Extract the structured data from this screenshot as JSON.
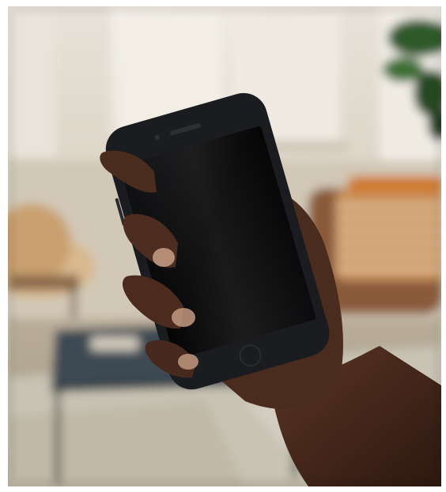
{
  "photo": {
    "subject": "hand-holding-smartphone",
    "screen_state": "off",
    "colors": {
      "wall": "#d8cfbf",
      "window_light": "#eeeae2",
      "plant": "#2f5a2a",
      "pillow": "#c9935e",
      "chair": "#8a5a3a",
      "table": "#3d4a52",
      "rug": "#c8c3b4",
      "skin": "#4a2c1f",
      "phone_body": "#1b1c1f",
      "phone_screen": "#060607"
    }
  }
}
